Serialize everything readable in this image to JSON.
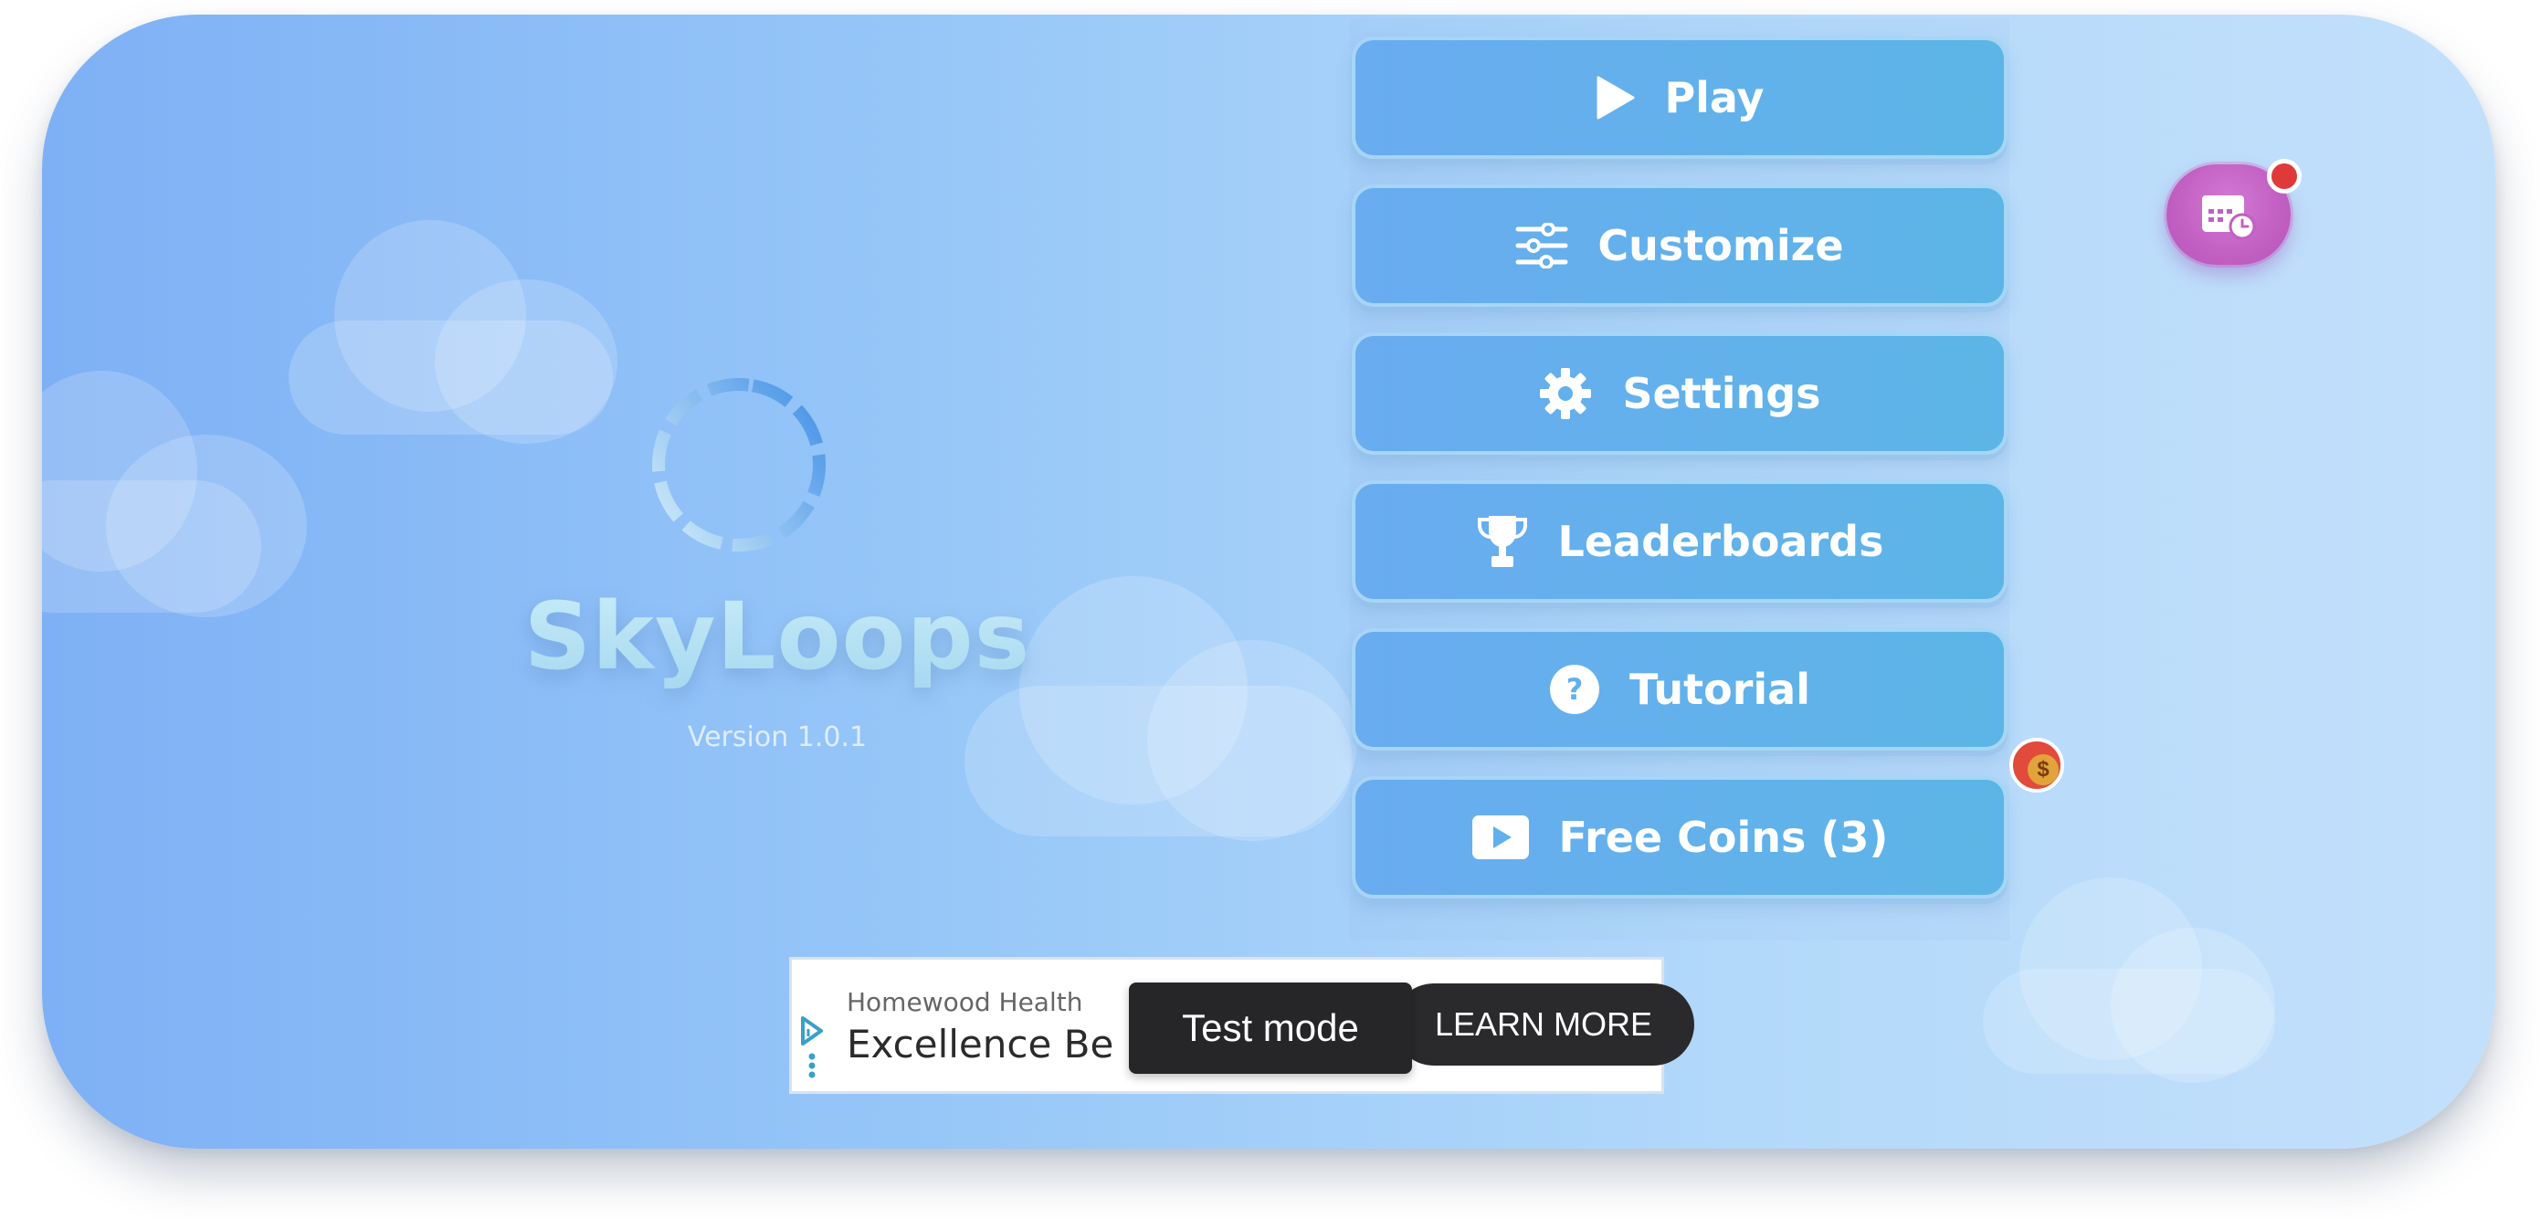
{
  "app": {
    "title": "SkyLoops",
    "version": "Version 1.0.1"
  },
  "menu": {
    "items": [
      {
        "label": "Play",
        "icon": "play-icon"
      },
      {
        "label": "Customize",
        "icon": "sliders-icon"
      },
      {
        "label": "Settings",
        "icon": "gear-icon"
      },
      {
        "label": "Leaderboards",
        "icon": "trophy-icon"
      },
      {
        "label": "Tutorial",
        "icon": "question-icon"
      },
      {
        "label": "Free Coins (3)",
        "icon": "video-play-icon"
      }
    ],
    "coin_badge_icon": "coin-icon",
    "coin_symbol": "$"
  },
  "daily_button": {
    "icon": "calendar-clock-icon",
    "has_notification": true
  },
  "ad": {
    "advertiser": "Homewood Health",
    "headline": "Excellence Be",
    "cta": "LEARN MORE",
    "test_mode": "Test mode",
    "icon": "ad-choices-icon"
  },
  "colors": {
    "bg_left": "#7eb0f5",
    "bg_right": "#c3e0fb",
    "button": "#62b0ec",
    "title": "#bfe3f5",
    "calendar_button": "#c25fc2",
    "notification": "#e0393a"
  }
}
